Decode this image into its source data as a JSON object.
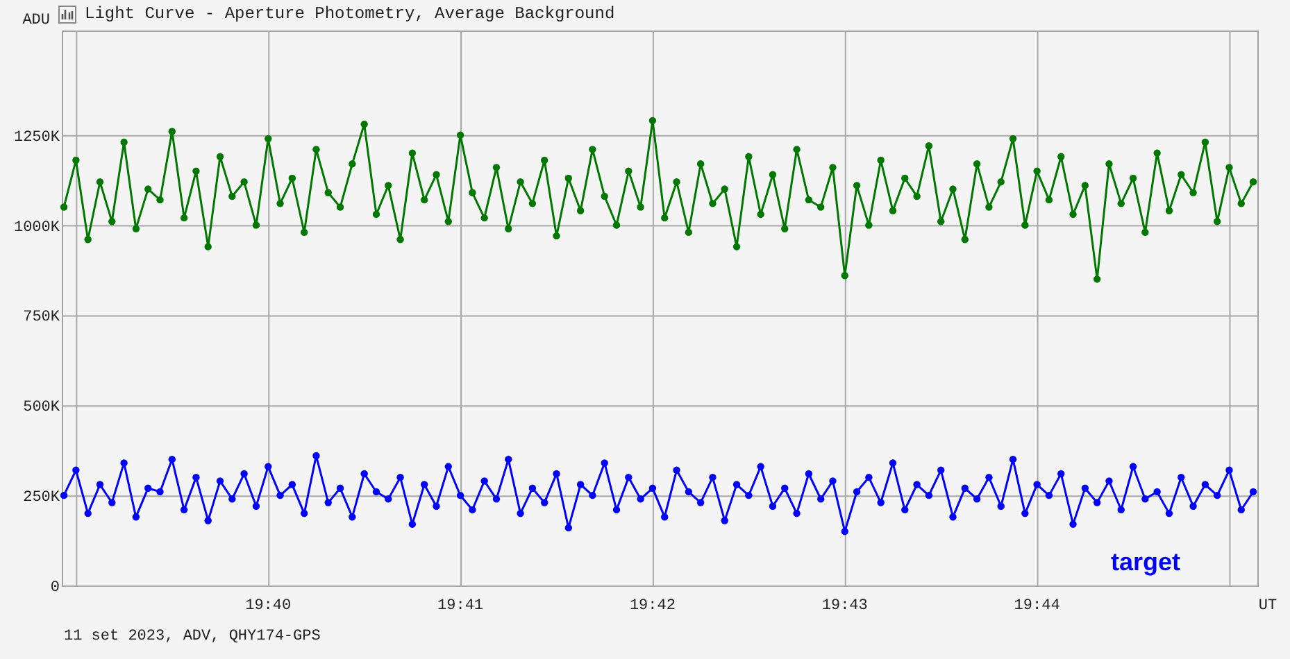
{
  "chart": {
    "chart_data": {
      "type": "line",
      "title": "Light Curve - Aperture Photometry, Average Background",
      "xlabel": "UT",
      "ylabel": "ADU",
      "categories": [
        null,
        null,
        null,
        null,
        null,
        null,
        null,
        null,
        null,
        null,
        null,
        null,
        null,
        null,
        null,
        null,
        null,
        "19:40",
        null,
        null,
        null,
        null,
        null,
        null,
        null,
        null,
        null,
        null,
        null,
        null,
        null,
        null,
        null,
        "19:41",
        null,
        null,
        null,
        null,
        null,
        null,
        null,
        null,
        null,
        null,
        null,
        null,
        null,
        null,
        null,
        "19:42",
        null,
        null,
        null,
        null,
        null,
        null,
        null,
        null,
        null,
        null,
        null,
        null,
        null,
        null,
        null,
        "19:43",
        null,
        null,
        null,
        null,
        null,
        null,
        null,
        null,
        null,
        null,
        null,
        null,
        null,
        null,
        null,
        "19:44",
        null,
        null,
        null,
        null,
        null,
        null,
        null,
        null,
        null,
        null,
        null,
        null,
        null,
        null,
        null,
        null,
        null,
        null
      ],
      "series": [
        {
          "color": "#007800",
          "marker": "circle",
          "values": [
            1050,
            1180,
            960,
            1120,
            1010,
            1230,
            990,
            1100,
            1070,
            1260,
            1020,
            1150,
            940,
            1190,
            1080,
            1120,
            1000,
            1240,
            1060,
            1130,
            980,
            1210,
            1090,
            1050,
            1170,
            1280,
            1030,
            1110,
            960,
            1200,
            1070,
            1140,
            1010,
            1250,
            1090,
            1020,
            1160,
            990,
            1120,
            1060,
            1180,
            970,
            1130,
            1040,
            1210,
            1080,
            1000,
            1150,
            1050,
            1290,
            1020,
            1120,
            980,
            1170,
            1060,
            1100,
            940,
            1190,
            1030,
            1140,
            990,
            1210,
            1070,
            1050,
            1160,
            860,
            1110,
            1000,
            1180,
            1040,
            1130,
            1080,
            1220,
            1010,
            1100,
            960,
            1170,
            1050,
            1120,
            1240,
            1000,
            1150,
            1070,
            1190,
            1030,
            1110,
            850,
            1170,
            1060,
            1130,
            980,
            1200,
            1040,
            1140,
            1090,
            1230,
            1010,
            1160,
            1060,
            1120
          ]
        },
        {
          "name": "target",
          "color": "#0000ff",
          "marker": "circle",
          "values": [
            250,
            320,
            200,
            280,
            230,
            340,
            190,
            270,
            260,
            350,
            210,
            300,
            180,
            290,
            240,
            310,
            220,
            330,
            250,
            280,
            200,
            360,
            230,
            270,
            190,
            310,
            260,
            240,
            300,
            170,
            280,
            220,
            330,
            250,
            210,
            290,
            240,
            350,
            200,
            270,
            230,
            310,
            160,
            280,
            250,
            340,
            210,
            300,
            240,
            270,
            190,
            320,
            260,
            230,
            300,
            180,
            280,
            250,
            330,
            220,
            270,
            200,
            310,
            240,
            290,
            150,
            260,
            300,
            230,
            340,
            210,
            280,
            250,
            320,
            190,
            270,
            240,
            300,
            220,
            350,
            200,
            280,
            250,
            310,
            170,
            270,
            230,
            290,
            210,
            330,
            240,
            260,
            200,
            300,
            220,
            280,
            250,
            320,
            210,
            260
          ]
        }
      ],
      "ylim": [
        0,
        1540
      ],
      "grid": true,
      "yticks": [
        {
          "value": 0,
          "label": "0"
        },
        {
          "value": 250,
          "label": "250K"
        },
        {
          "value": 500,
          "label": "500K"
        },
        {
          "value": 750,
          "label": "750K"
        },
        {
          "value": 1000,
          "label": "1000K"
        },
        {
          "value": 1250,
          "label": "1250K"
        }
      ]
    }
  },
  "status_bar": {
    "text": "11 set 2023, ADV, QHY174-GPS"
  }
}
